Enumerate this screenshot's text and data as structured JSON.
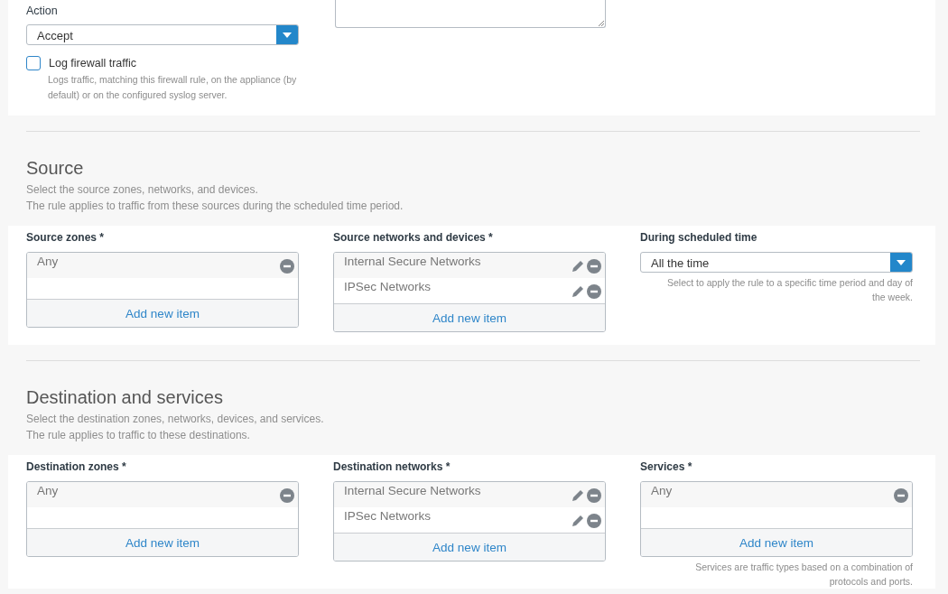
{
  "action": {
    "label": "Action",
    "value": "Accept"
  },
  "log": {
    "label": "Log firewall traffic",
    "checked": false,
    "hint": "Logs traffic, matching this firewall rule, on the appliance (by default) or on the configured syslog server."
  },
  "sections": [
    {
      "title": "Source",
      "lines": [
        "Select the source zones, networks, and devices.",
        "The rule applies to traffic from these sources during the scheduled time period."
      ],
      "fields": [
        {
          "kind": "list",
          "label": "Source zones *",
          "items": [
            {
              "text": "Any",
              "editable": false
            }
          ],
          "add": "Add new item"
        },
        {
          "kind": "list",
          "label": "Source networks and devices *",
          "items": [
            {
              "text": "Internal Secure Networks",
              "editable": true
            },
            {
              "text": "IPSec Networks",
              "editable": true
            }
          ],
          "add": "Add new item"
        },
        {
          "kind": "select",
          "label": "During scheduled time",
          "value": "All the time",
          "hint": "Select to apply the rule to a specific time period and day of the week."
        }
      ]
    },
    {
      "title": "Destination and services",
      "lines": [
        "Select the destination zones, networks, devices, and services.",
        "The rule applies to traffic to these destinations."
      ],
      "fields": [
        {
          "kind": "list",
          "label": "Destination zones *",
          "items": [
            {
              "text": "Any",
              "editable": false
            }
          ],
          "add": "Add new item"
        },
        {
          "kind": "list",
          "label": "Destination networks *",
          "items": [
            {
              "text": "Internal Secure Networks",
              "editable": true
            },
            {
              "text": "IPSec Networks",
              "editable": true
            }
          ],
          "add": "Add new item"
        },
        {
          "kind": "list",
          "label": "Services *",
          "items": [
            {
              "text": "Any",
              "editable": false
            }
          ],
          "add": "Add new item",
          "hint": "Services are traffic types based on a combination of protocols and ports."
        }
      ]
    }
  ]
}
